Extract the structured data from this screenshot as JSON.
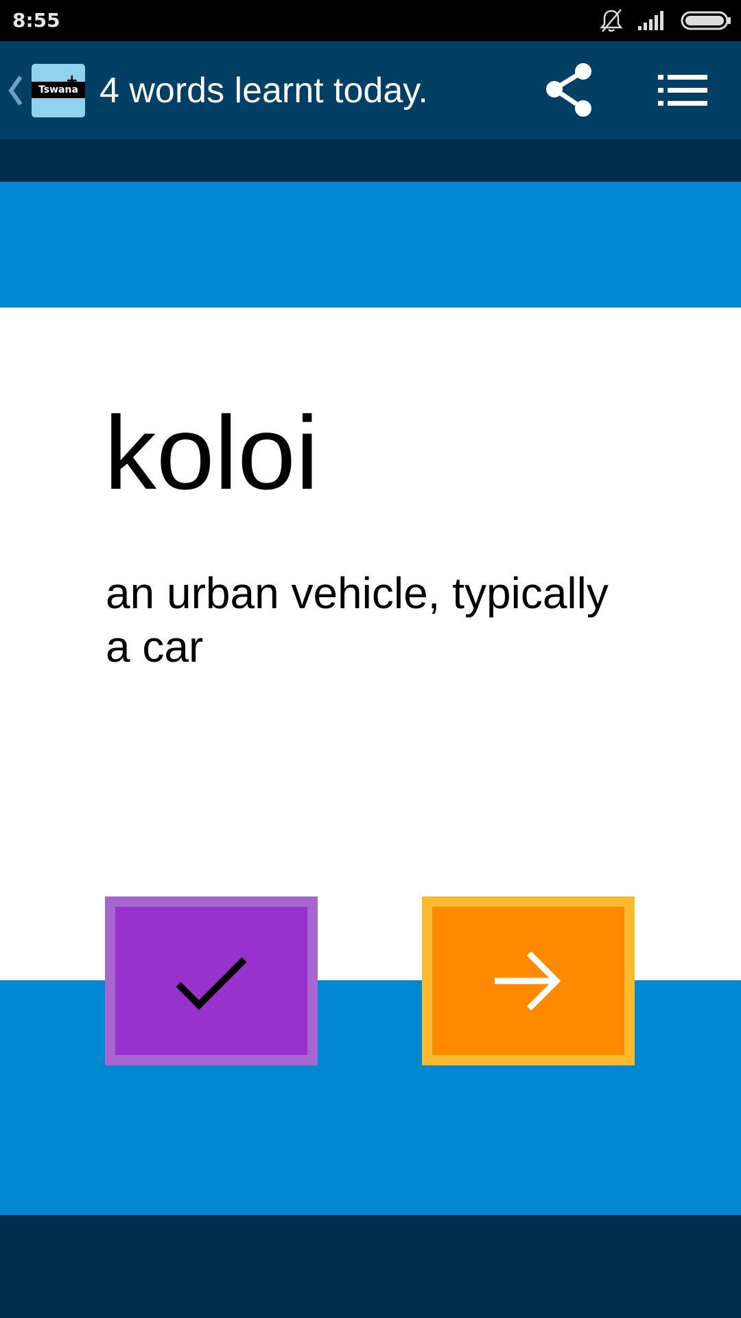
{
  "status_bar": {
    "time": "8:55",
    "icons": [
      "bell-muted-icon",
      "signal-icon",
      "battery-icon"
    ]
  },
  "app_bar": {
    "logo_text": "Tswana",
    "logo_badge": "+",
    "title": "4 words learnt today.",
    "actions": [
      "share-icon",
      "list-menu-icon"
    ]
  },
  "flashcard": {
    "word": "koloi",
    "definition": "an urban vehicle, typically a car"
  },
  "actions": {
    "known_icon": "checkmark-icon",
    "next_icon": "arrow-right-icon"
  },
  "colors": {
    "status_bar": "#000000",
    "app_bar": "#013f64",
    "dark_navy": "#012c4b",
    "blue_band": "#0288d1",
    "known_button": "#9932cc",
    "known_button_border": "#a866d0",
    "next_button": "#ff8a00",
    "next_button_border": "#fdb930"
  }
}
